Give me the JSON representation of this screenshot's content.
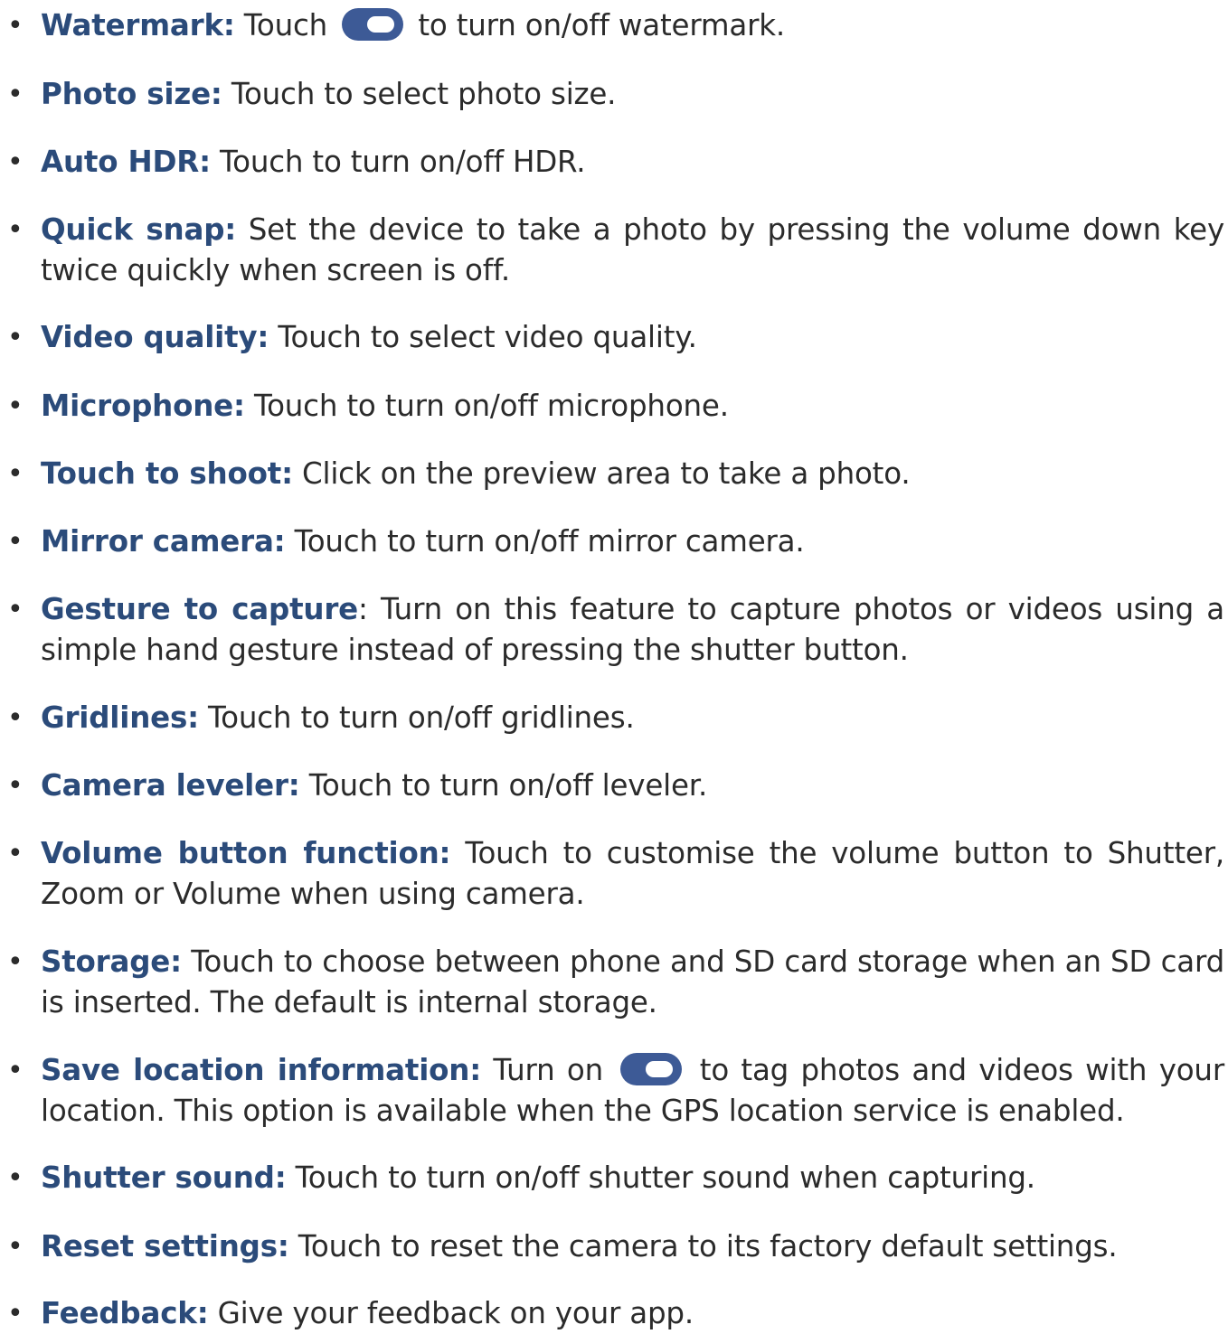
{
  "items": [
    {
      "term": "Watermark:",
      "before_toggle": " Touch ",
      "after_toggle": " to turn on/off watermark."
    },
    {
      "term": "Photo size:",
      "text": " Touch to select photo size."
    },
    {
      "term": "Auto HDR:",
      "text": " Touch to turn on/off HDR."
    },
    {
      "term": "Quick snap:",
      "text": " Set the device to take a photo by pressing the volume down key twice quickly when screen is off."
    },
    {
      "term": "Video quality:",
      "text": " Touch to select video quality."
    },
    {
      "term": "Microphone:",
      "text": " Touch to turn on/off microphone."
    },
    {
      "term": "Touch to shoot:",
      "text": " Click on the preview area to take a photo."
    },
    {
      "term": "Mirror camera:",
      "text": " Touch to turn on/off mirror camera."
    },
    {
      "term": "Gesture to capture",
      "text": ": Turn on this feature to capture photos or videos using a simple hand gesture instead of pressing the shutter button."
    },
    {
      "term": "Gridlines:",
      "text": " Touch to turn on/off gridlines."
    },
    {
      "term": "Camera leveler:",
      "text": " Touch to turn on/off leveler."
    },
    {
      "term": "Volume button function:",
      "text": " Touch to customise the volume button to Shutter, Zoom or Volume when using camera."
    },
    {
      "term": "Storage:",
      "text": " Touch to choose between phone and SD card storage when an SD card is inserted. The default is internal storage."
    },
    {
      "term": "Save location information:",
      "before_toggle": " Turn on ",
      "after_toggle": " to tag photos and videos with your location. This option is available when the GPS location service is enabled."
    },
    {
      "term": "Shutter sound:",
      "text": " Touch to turn on/off shutter sound when capturing."
    },
    {
      "term": "Reset settings:",
      "text": " Touch to reset the camera to its factory default settings."
    },
    {
      "term": "Feedback:",
      "text": " Give your feedback on your app."
    }
  ],
  "bullet_glyph": "•",
  "toggle_icon": "toggle-on-icon",
  "colors": {
    "term": "#2b4b7a",
    "body_text": "#2b2b2b",
    "toggle_track": "#3d5a96",
    "toggle_knob": "#ffffff"
  }
}
